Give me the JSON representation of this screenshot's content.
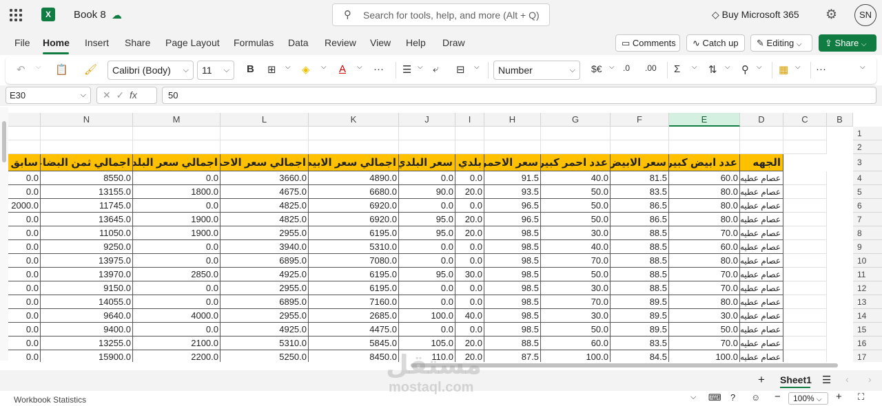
{
  "app": {
    "title": "Book 8",
    "brand_color": "#107c41"
  },
  "search": {
    "placeholder": "Search for tools, help, and more (Alt + Q)"
  },
  "header": {
    "buy": "Buy Microsoft 365",
    "avatar": "SN"
  },
  "menu": {
    "tabs": [
      "File",
      "Home",
      "Insert",
      "Share",
      "Page Layout",
      "Formulas",
      "Data",
      "Review",
      "View",
      "Help",
      "Draw"
    ],
    "active": "Home",
    "comments": "Comments",
    "catchup": "Catch up",
    "editing": "Editing",
    "share": "Share"
  },
  "ribbon": {
    "font": "Calibri (Body)",
    "size": "11",
    "number_format": "Number",
    "currency": "$€"
  },
  "formula_bar": {
    "namebox": "E30",
    "fx": "fx",
    "value": "50"
  },
  "grid": {
    "columns": [
      "N",
      "M",
      "L",
      "K",
      "J",
      "I",
      "H",
      "G",
      "F",
      "E",
      "D",
      "C",
      "B"
    ],
    "selected_column": "E",
    "row_numbers": [
      "1",
      "2",
      "3",
      "4",
      "5",
      "6",
      "7",
      "8",
      "9",
      "10",
      "11",
      "12",
      "13",
      "14",
      "15",
      "16",
      "17"
    ],
    "headers": [
      "سابق ح",
      "اجمالي ثمن البضاعه",
      "اجمالي سعر البلدي",
      "اجمالي سعر الاحمر",
      "اجمالي سعر الابيض",
      "سعر البلدي",
      "بلدي",
      "سعر الاحمر",
      "عدد احمر كبير",
      "سعر الابيض",
      "عدد ابيض كبير",
      "الجهه"
    ],
    "rows": [
      [
        "0.0",
        "8550.0",
        "0.0",
        "3660.0",
        "4890.0",
        "0.0",
        "0.0",
        "91.5",
        "40.0",
        "81.5",
        "60.0",
        "عصام عطيه"
      ],
      [
        "0.0",
        "13155.0",
        "1800.0",
        "4675.0",
        "6680.0",
        "90.0",
        "20.0",
        "93.5",
        "50.0",
        "83.5",
        "80.0",
        "عصام عطيه"
      ],
      [
        "2000.0",
        "11745.0",
        "0.0",
        "4825.0",
        "6920.0",
        "0.0",
        "0.0",
        "96.5",
        "50.0",
        "86.5",
        "80.0",
        "عصام عطيه"
      ],
      [
        "0.0",
        "13645.0",
        "1900.0",
        "4825.0",
        "6920.0",
        "95.0",
        "20.0",
        "96.5",
        "50.0",
        "86.5",
        "80.0",
        "عصام عطيه"
      ],
      [
        "0.0",
        "11050.0",
        "1900.0",
        "2955.0",
        "6195.0",
        "95.0",
        "20.0",
        "98.5",
        "30.0",
        "88.5",
        "70.0",
        "عصام عطيه"
      ],
      [
        "0.0",
        "9250.0",
        "0.0",
        "3940.0",
        "5310.0",
        "0.0",
        "0.0",
        "98.5",
        "40.0",
        "88.5",
        "60.0",
        "عصام عطيه"
      ],
      [
        "0.0",
        "13975.0",
        "0.0",
        "6895.0",
        "7080.0",
        "0.0",
        "0.0",
        "98.5",
        "70.0",
        "88.5",
        "80.0",
        "عصام عطيه"
      ],
      [
        "0.0",
        "13970.0",
        "2850.0",
        "4925.0",
        "6195.0",
        "95.0",
        "30.0",
        "98.5",
        "50.0",
        "88.5",
        "70.0",
        "عصام عطيه"
      ],
      [
        "0.0",
        "9150.0",
        "0.0",
        "2955.0",
        "6195.0",
        "0.0",
        "0.0",
        "98.5",
        "30.0",
        "88.5",
        "70.0",
        "عصام عطيه"
      ],
      [
        "0.0",
        "14055.0",
        "0.0",
        "6895.0",
        "7160.0",
        "0.0",
        "0.0",
        "98.5",
        "70.0",
        "89.5",
        "80.0",
        "عصام عطيه"
      ],
      [
        "0.0",
        "9640.0",
        "4000.0",
        "2955.0",
        "2685.0",
        "100.0",
        "40.0",
        "98.5",
        "30.0",
        "89.5",
        "30.0",
        "عصام عطيه"
      ],
      [
        "0.0",
        "9400.0",
        "0.0",
        "4925.0",
        "4475.0",
        "0.0",
        "0.0",
        "98.5",
        "50.0",
        "89.5",
        "50.0",
        "عصام عطيه"
      ],
      [
        "0.0",
        "13255.0",
        "2100.0",
        "5310.0",
        "5845.0",
        "105.0",
        "20.0",
        "88.5",
        "60.0",
        "83.5",
        "70.0",
        "عصام عطيه"
      ],
      [
        "0.0",
        "15900.0",
        "2200.0",
        "5250.0",
        "8450.0",
        "110.0",
        "20.0",
        "87.5",
        "100.0",
        "84.5",
        "100.0",
        "عصام عطيه"
      ]
    ]
  },
  "sheets": {
    "active": "Sheet1"
  },
  "status": {
    "left": "Workbook Statistics",
    "zoom": "100%"
  },
  "watermark": {
    "brand": "mostaql.com"
  }
}
